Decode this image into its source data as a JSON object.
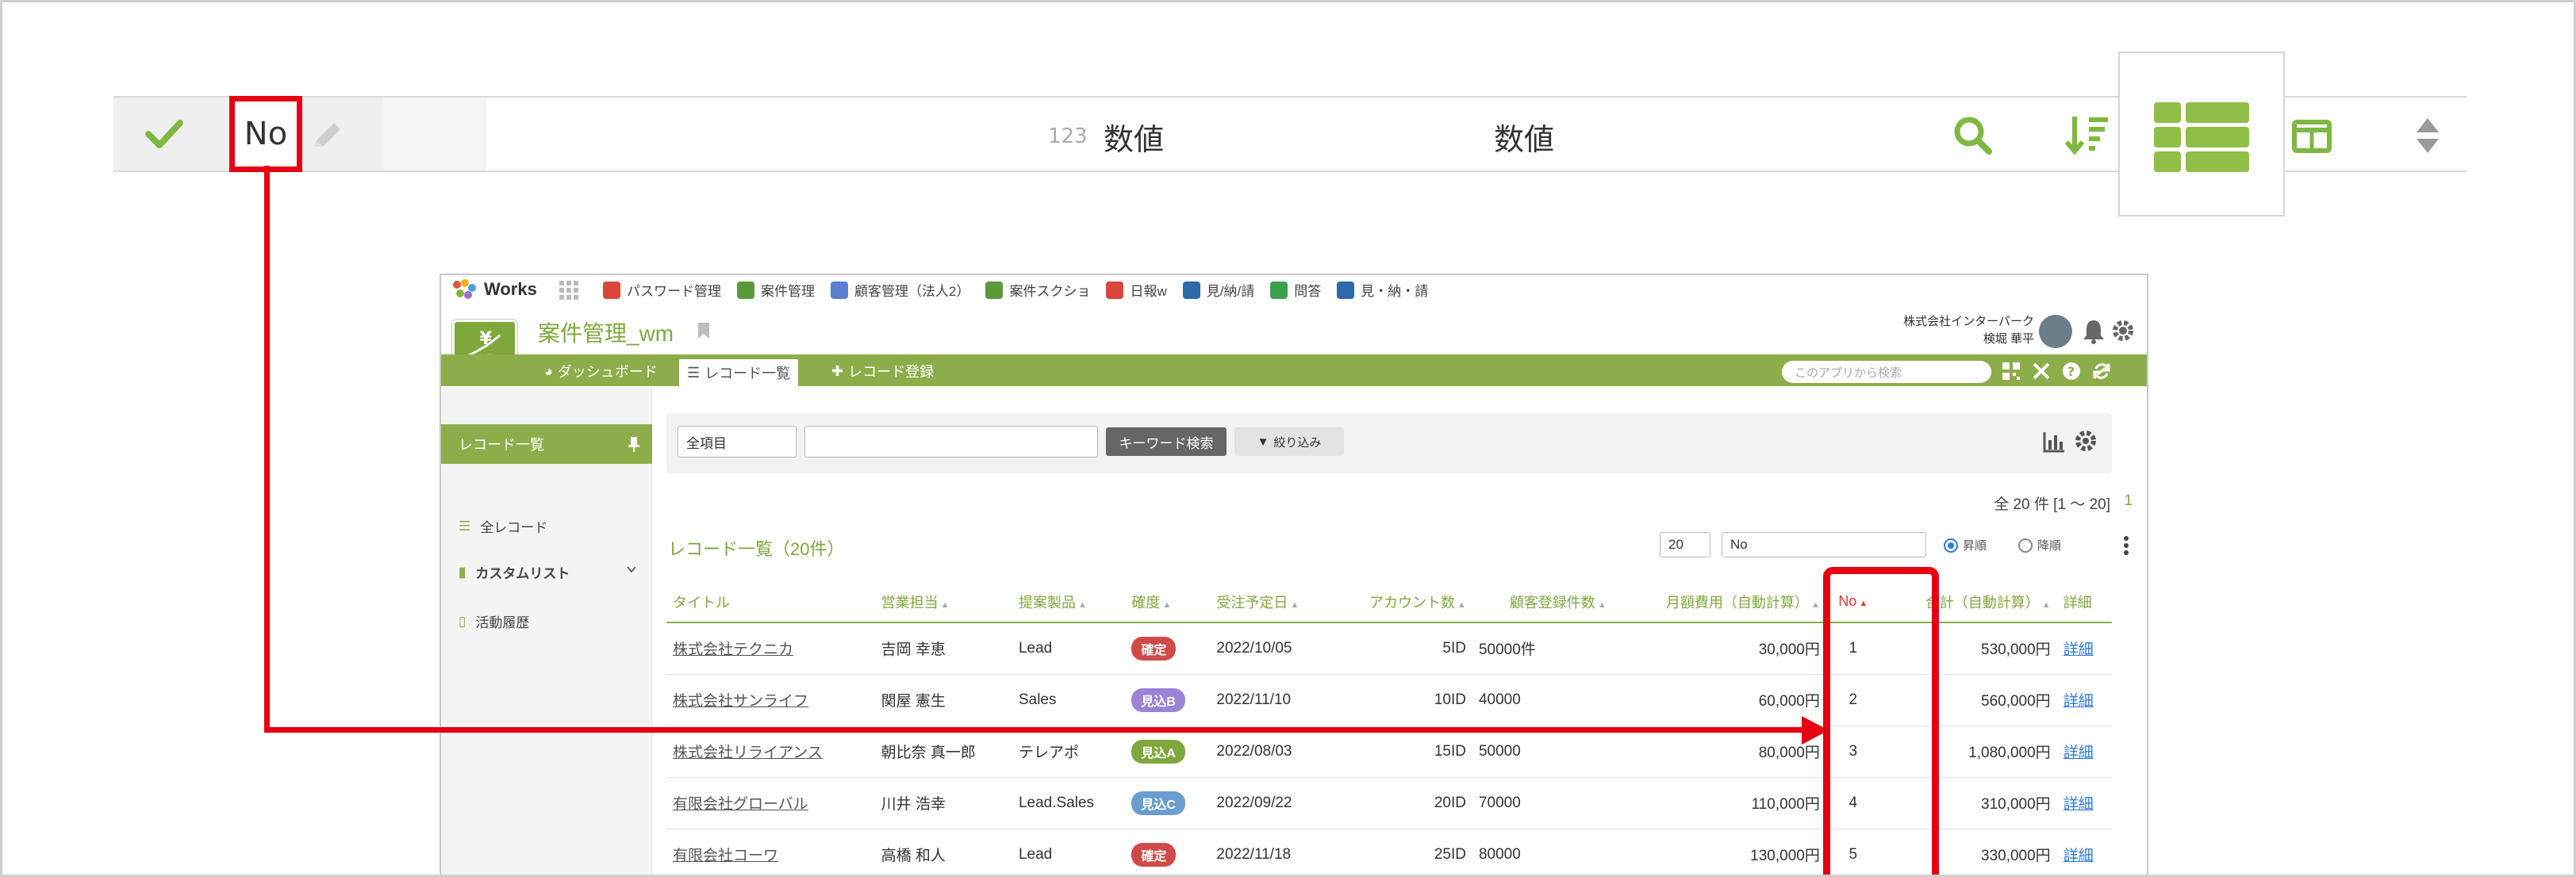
{
  "field_bar": {
    "field_name": "No",
    "type_prefix": "123",
    "type_label": "数値",
    "display_label": "数値"
  },
  "app": {
    "brand": "Works",
    "app_tabs": [
      {
        "label": "パスワード管理",
        "color": "#d9463b"
      },
      {
        "label": "案件管理",
        "color": "#5a9a3a"
      },
      {
        "label": "顧客管理（法人2）",
        "color": "#5a7fd0"
      },
      {
        "label": "案件スクショ",
        "color": "#5a9a3a"
      },
      {
        "label": "日報w",
        "color": "#d9463b"
      },
      {
        "label": "見/納/請",
        "color": "#2e6aa8"
      },
      {
        "label": "問答",
        "color": "#3aa14a"
      },
      {
        "label": "見・納・請",
        "color": "#2e6aa8"
      }
    ],
    "app_title": "案件管理_wm",
    "company": "株式会社インターパーク",
    "user": "検堀 華平",
    "nav": {
      "dashboard": "ダッシュボード",
      "record_list": "レコード一覧",
      "record_add": "レコード登録",
      "search_placeholder": "このアプリから検索"
    },
    "sidebar": {
      "header": "レコード一覧",
      "all_records": "全レコード",
      "custom_list": "カスタムリスト",
      "history": "活動履歴"
    },
    "search": {
      "field_select": "全項目",
      "keyword_button": "キーワード検索",
      "filter_button": "絞り込み"
    },
    "list": {
      "count_text": "全 20 件 [1 〜 20]",
      "current_page": "1",
      "title": "レコード一覧（20件）",
      "per_page": "20",
      "sort_field": "No",
      "asc_label": "昇順",
      "desc_label": "降順"
    },
    "table": {
      "headers": [
        "タイトル",
        "営業担当",
        "提案製品",
        "確度",
        "受注予定日",
        "アカウント数",
        "顧客登録件数",
        "月額費用（自動計算）",
        "No",
        "合計（自動計算）",
        "詳細"
      ],
      "rows": [
        {
          "title": "株式会社テクニカ",
          "rep": "吉岡 幸恵",
          "product": "Lead",
          "status": "確定",
          "status_color": "#d04a4a",
          "date": "2022/10/05",
          "accounts": "5ID",
          "customers": "50000件",
          "monthly": "30,000円",
          "no": "1",
          "total": "530,000円",
          "detail": "詳細"
        },
        {
          "title": "株式会社サンライフ",
          "rep": "関屋 憲生",
          "product": "Sales",
          "status": "見込B",
          "status_color": "#9b83d6",
          "date": "2022/11/10",
          "accounts": "10ID",
          "customers": "40000",
          "monthly": "60,000円",
          "no": "2",
          "total": "560,000円",
          "detail": "詳細"
        },
        {
          "title": "株式会社リライアンス",
          "rep": "朝比奈 真一郎",
          "product": "テレアポ",
          "status": "見込A",
          "status_color": "#7fa83c",
          "date": "2022/08/03",
          "accounts": "15ID",
          "customers": "50000",
          "monthly": "80,000円",
          "no": "3",
          "total": "1,080,000円",
          "detail": "詳細"
        },
        {
          "title": "有限会社グローバル",
          "rep": "川井 浩幸",
          "product": "Lead.Sales",
          "status": "見込C",
          "status_color": "#6a9ed0",
          "date": "2022/09/22",
          "accounts": "20ID",
          "customers": "70000",
          "monthly": "110,000円",
          "no": "4",
          "total": "310,000円",
          "detail": "詳細"
        },
        {
          "title": "有限会社コーワ",
          "rep": "高橋 和人",
          "product": "Lead",
          "status": "確定",
          "status_color": "#d04a4a",
          "date": "2022/11/18",
          "accounts": "25ID",
          "customers": "80000",
          "monthly": "130,000円",
          "no": "5",
          "total": "330,000円",
          "detail": "詳細"
        }
      ]
    }
  },
  "colors": {
    "accent_green": "#8dad4a",
    "highlight_red": "#e60012",
    "link_blue": "#2d7cd6"
  }
}
